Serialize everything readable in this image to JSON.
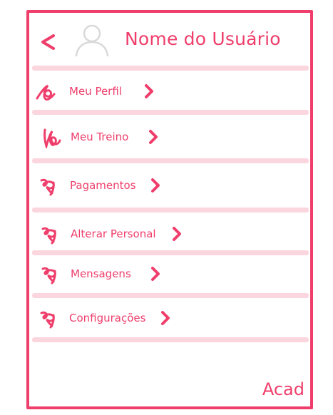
{
  "header": {
    "title": "Nome do Usuário",
    "back_icon": "chevron-left-icon",
    "avatar_icon": "user-avatar-icon"
  },
  "menu": {
    "items": [
      {
        "label": "Meu Perfil"
      },
      {
        "label": "Meu Treino"
      },
      {
        "label": "Pagamentos"
      },
      {
        "label": "Alterar Personal"
      },
      {
        "label": "Mensagens"
      },
      {
        "label": "Configurações"
      }
    ],
    "item_icon": "scribble-icon",
    "chevron_icon": "chevron-right-icon"
  },
  "footer": {
    "brand": "Acad"
  },
  "colors": {
    "accent": "#ef3e6b",
    "divider": "#fbd6de",
    "avatar": "#d9d9d9"
  }
}
